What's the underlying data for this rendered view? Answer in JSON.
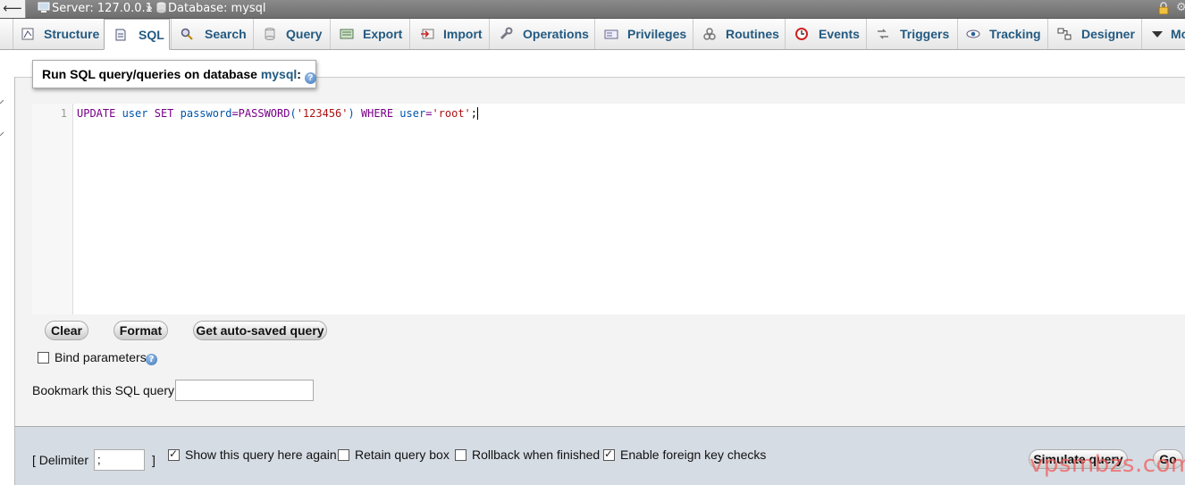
{
  "breadcrumb": {
    "back_glyph": "⟵",
    "server": "Server: 127.0.0.1",
    "separator": "»",
    "database": "Database: mysql"
  },
  "tabs": [
    {
      "label": "Structure",
      "icon": "structure-icon"
    },
    {
      "label": "SQL",
      "icon": "sql-icon",
      "active": true
    },
    {
      "label": "Search",
      "icon": "search-icon"
    },
    {
      "label": "Query",
      "icon": "query-icon"
    },
    {
      "label": "Export",
      "icon": "export-icon"
    },
    {
      "label": "Import",
      "icon": "import-icon"
    },
    {
      "label": "Operations",
      "icon": "wrench-icon"
    },
    {
      "label": "Privileges",
      "icon": "privileges-icon"
    },
    {
      "label": "Routines",
      "icon": "routines-icon"
    },
    {
      "label": "Events",
      "icon": "clock-icon"
    },
    {
      "label": "Triggers",
      "icon": "triggers-icon"
    },
    {
      "label": "Tracking",
      "icon": "eye-icon"
    },
    {
      "label": "Designer",
      "icon": "designer-icon"
    },
    {
      "label": "Mo",
      "icon": "chevron-down-icon"
    }
  ],
  "legend": {
    "text": "Run SQL query/queries on database ",
    "database": "mysql",
    "suffix": ":"
  },
  "editor": {
    "line_number": "1",
    "tokens": {
      "t1": "UPDATE",
      "t2": " user ",
      "t3": "SET",
      "t4": " password",
      "t5": "=",
      "t6": "PASSWORD",
      "t7": "(",
      "t8": "'123456'",
      "t9": ") ",
      "t10": "WHERE",
      "t11": " user",
      "t12": "=",
      "t13": "'root'",
      "t14": ";"
    }
  },
  "buttons": {
    "clear": "Clear",
    "format": "Format",
    "autosaved": "Get auto-saved query",
    "simulate": "Simulate query",
    "go": "Go"
  },
  "bind_parameters": {
    "label": "Bind parameters",
    "checked": false
  },
  "bookmark": {
    "label": "Bookmark this SQL query:",
    "value": ""
  },
  "options": {
    "delimiter_open": "[ Delimiter",
    "delimiter_value": ";",
    "delimiter_close": "]",
    "show_query_again": {
      "label": "Show this query here again",
      "checked": true
    },
    "retain_query_box": {
      "label": "Retain query box",
      "checked": false
    },
    "rollback": {
      "label": "Rollback when finished",
      "checked": false
    },
    "foreign_keys": {
      "label": "Enable foreign key checks",
      "checked": true
    }
  },
  "watermark": "vpsmbzs.com",
  "colors": {
    "link_blue": "#235a81",
    "keyword": "#770088",
    "string": "#aa1111",
    "bottom_bar": "#d5dce4"
  }
}
